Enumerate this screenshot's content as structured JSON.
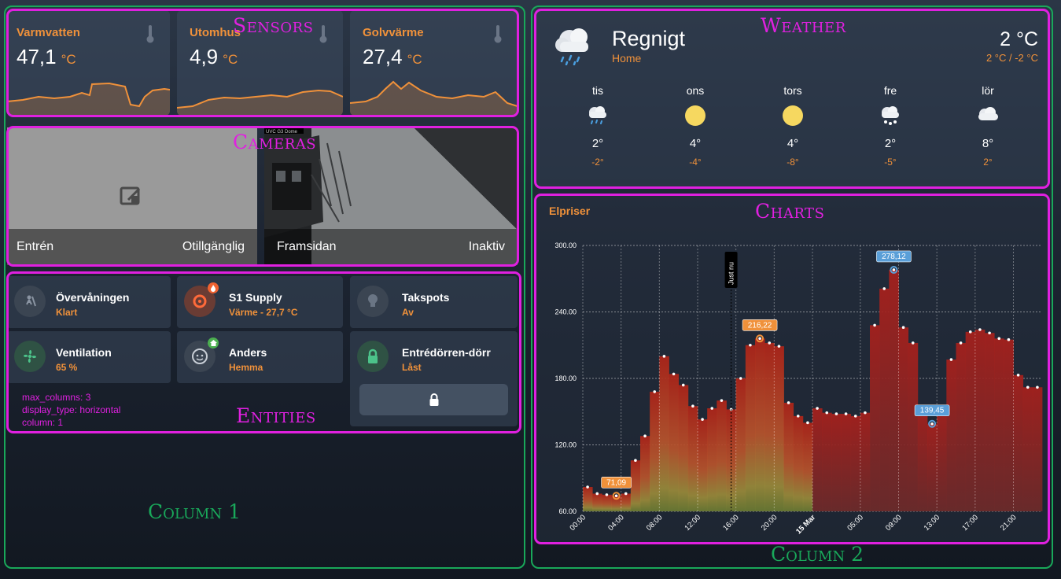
{
  "columns": {
    "col1_title": "Column 1",
    "col2_title": "Column 2"
  },
  "sections": {
    "sensors": "Sensors",
    "cameras": "Cameras",
    "entities": "Entities",
    "weather": "Weather",
    "charts": "Charts"
  },
  "sensors": [
    {
      "name": "Varmvatten",
      "value": "47,1",
      "unit": "°C",
      "icon": "thermometer-icon"
    },
    {
      "name": "Utomhus",
      "value": "4,9",
      "unit": "°C",
      "icon": "thermometer-icon"
    },
    {
      "name": "Golvvärme",
      "value": "27,4",
      "unit": "°C",
      "icon": "thermometer-icon"
    }
  ],
  "cameras": [
    {
      "name": "Entrén",
      "status": "Otillgänglig",
      "icon": "camera-off-icon"
    },
    {
      "name": "Framsidan",
      "status": "Inaktiv",
      "overlay_text": "UVC G3 Dome"
    }
  ],
  "entities": [
    {
      "name": "Övervåningen",
      "state": "Klart",
      "icon": "robot-vacuum-icon"
    },
    {
      "name": "S1 Supply",
      "state": "Värme - 27,7 °C",
      "icon": "thermostat-icon",
      "badge": "flame-icon"
    },
    {
      "name": "Takspots",
      "state": "Av",
      "icon": "lightbulb-icon"
    },
    {
      "name": "Ventilation",
      "state": "65 %",
      "icon": "fan-icon"
    },
    {
      "name": "Anders",
      "state": "Hemma",
      "icon": "face-icon",
      "badge": "home-icon"
    },
    {
      "name": "Entrédörren-dörr",
      "state": "Låst",
      "icon": "lock-icon"
    }
  ],
  "entities_note": [
    "max_columns: 3",
    "display_type: horizontal",
    "column: 1"
  ],
  "weather": {
    "condition": "Regnigt",
    "location": "Home",
    "temperature": "2 °C",
    "hi_lo": "2 °C / -2 °C",
    "forecast": [
      {
        "day": "tis",
        "hi": "2°",
        "lo": "-2°",
        "icon": "rain-icon"
      },
      {
        "day": "ons",
        "hi": "4°",
        "lo": "-4°",
        "icon": "sun-icon"
      },
      {
        "day": "tors",
        "hi": "4°",
        "lo": "-8°",
        "icon": "sun-icon"
      },
      {
        "day": "fre",
        "hi": "2°",
        "lo": "-5°",
        "icon": "snow-icon"
      },
      {
        "day": "lör",
        "hi": "8°",
        "lo": "2°",
        "icon": "cloud-icon"
      }
    ]
  },
  "colors": {
    "accent": "#f0913a",
    "section": "#e020e0",
    "column": "#19a85a",
    "min_marker": "#f0913a",
    "max_marker": "#5a9fd8"
  },
  "chart_data": {
    "type": "bar",
    "title": "Elpriser",
    "now_label": "Just nu",
    "ylim": [
      60,
      300
    ],
    "yticks": [
      "60.00",
      "120.00",
      "180.00",
      "240.00",
      "300.00"
    ],
    "xticks": [
      "00:00",
      "04:00",
      "08:00",
      "12:00",
      "16:00",
      "20:00",
      "15 Mar",
      "05:00",
      "09:00",
      "13:00",
      "17:00",
      "21:00"
    ],
    "grid": true,
    "series": [
      {
        "values": [
          82,
          76,
          75,
          74,
          76,
          106,
          128,
          168,
          200,
          184,
          174,
          155,
          143,
          153,
          160,
          152,
          180,
          210,
          216,
          212,
          209,
          158,
          146,
          140
        ]
      },
      {
        "values": [
          153,
          149,
          148,
          148,
          146,
          149,
          228,
          261,
          278,
          226,
          212,
          153,
          139,
          152,
          197,
          212,
          222,
          224,
          221,
          216,
          215,
          183,
          172,
          172
        ]
      }
    ],
    "annotations": [
      {
        "label": "71,09",
        "kind": "min"
      },
      {
        "label": "216,22",
        "kind": "max"
      },
      {
        "label": "278,12",
        "kind": "max"
      },
      {
        "label": "139,45",
        "kind": "min"
      }
    ]
  }
}
